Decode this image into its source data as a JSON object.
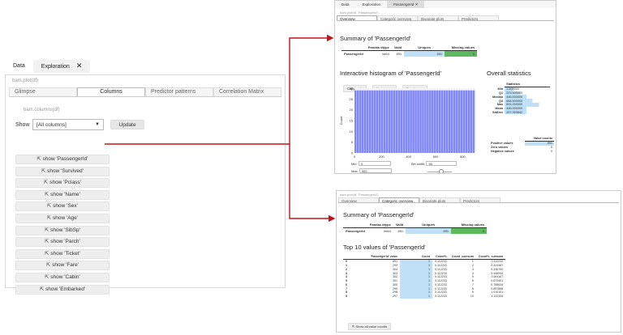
{
  "left": {
    "tabs": [
      "Data",
      "Exploration"
    ],
    "close_glyph": "✕",
    "code_call": "bam.plot(df)",
    "subtabs": [
      "Glimpse",
      "Columns",
      "Predictor patterns",
      "Correlation Matrix"
    ],
    "columns_call": "bam.columns(df)",
    "show_label": "Show",
    "show_select_value": "[All columns]",
    "update_label": "Update",
    "buttons": [
      "show 'PassengerId'",
      "show 'Survived'",
      "show 'Pclass'",
      "show 'Name'",
      "show 'Sex'",
      "show 'Age'",
      "show 'SibSp'",
      "show 'Parch'",
      "show 'Ticket'",
      "show 'Fare'",
      "show 'Cabin'",
      "show 'Embarked'"
    ],
    "link_icon": "external-link-icon"
  },
  "top_panel": {
    "tabs": [
      "Data",
      "Exploration",
      "PassengerId"
    ],
    "code_call": "bam.plot(df, 'PassengerId')",
    "subtabs": [
      "Overview",
      "Categoric overview",
      "Bivariate plots",
      "Predictors"
    ],
    "summary_title": "Summary of 'PassengerId'",
    "summary_headers": [
      "",
      "Pandas dtype",
      "Valid",
      "Uniques",
      "Missing values"
    ],
    "summary_row": [
      "PassengerId",
      "int64",
      "891",
      "891",
      "0"
    ],
    "hist_title": "Interactive histogram of 'PassengerId'",
    "buttons": [
      "Copy code",
      "Undo zoom",
      "Reset zoom"
    ],
    "ylabel": "Count",
    "y_ticks": [
      "30",
      "25",
      "20",
      "15",
      "10",
      "5",
      "0"
    ],
    "x_ticks": [
      "0",
      "200",
      "400",
      "600",
      "800"
    ],
    "bar_count": 50,
    "bar_color": "#7f86f7",
    "min_label": "Min:",
    "min_value": "0",
    "max_label": "Max:",
    "max_value": "900",
    "binwidth_label": "Bin width:",
    "binwidth_value": "50",
    "overall_title": "Overall statistics",
    "stats_header": "Statistics",
    "stats": [
      [
        "Min",
        "1.000000"
      ],
      [
        "Q1",
        "223.500000"
      ],
      [
        "Median",
        "446.000000"
      ],
      [
        "Q3",
        "668.500000"
      ],
      [
        "Max",
        "891.000000"
      ],
      [
        "Mean",
        "446.000000"
      ],
      [
        "StdDev",
        "257.353842"
      ]
    ],
    "counts_header": "Value counts",
    "counts": [
      [
        "Positive values",
        "891"
      ],
      [
        "Zero values",
        "0"
      ],
      [
        "Negative values",
        "0"
      ]
    ]
  },
  "bottom_panel": {
    "code_call": "bam.plot(df, 'PassengerId')",
    "subtabs": [
      "Overview",
      "Categoric overview",
      "Bivariate plots",
      "Predictors"
    ],
    "summary_title": "Summary of 'PassengerId'",
    "summary_headers": [
      "",
      "Pandas dtype",
      "Valid",
      "Uniques",
      "Missing values"
    ],
    "summary_row": [
      "PassengerId",
      "int64",
      "891",
      "891",
      "0"
    ],
    "top_title": "Top 10 values of 'PassengerId'",
    "top_headers": [
      "",
      "'PassengerId' value",
      "Count",
      "Count%",
      "Count_cumsum",
      "Count%_cumsum"
    ],
    "top_rows": [
      [
        "0",
        "891",
        "1",
        "0.112233",
        "1",
        "0.112233"
      ],
      [
        "1",
        "293",
        "1",
        "0.112233",
        "2",
        "0.224467"
      ],
      [
        "2",
        "304",
        "1",
        "0.112233",
        "3",
        "0.336700"
      ],
      [
        "3",
        "303",
        "1",
        "0.112233",
        "4",
        "0.448934"
      ],
      [
        "4",
        "302",
        "1",
        "0.112233",
        "5",
        "0.561167"
      ],
      [
        "5",
        "301",
        "1",
        "0.112233",
        "6",
        "0.673401"
      ],
      [
        "6",
        "300",
        "1",
        "0.112233",
        "7",
        "0.785634"
      ],
      [
        "7",
        "299",
        "1",
        "0.112233",
        "8",
        "0.897868"
      ],
      [
        "8",
        "298",
        "1",
        "0.112233",
        "9",
        "1.010101"
      ],
      [
        "9",
        "297",
        "1",
        "0.112233",
        "10",
        "1.122334"
      ]
    ],
    "show_all_label": "Show all value counts"
  },
  "colors": {
    "arrow": "#c0141c",
    "uniques": "#bfe0f6",
    "missing": "#5cb85c",
    "bars": "#7f86f7"
  }
}
